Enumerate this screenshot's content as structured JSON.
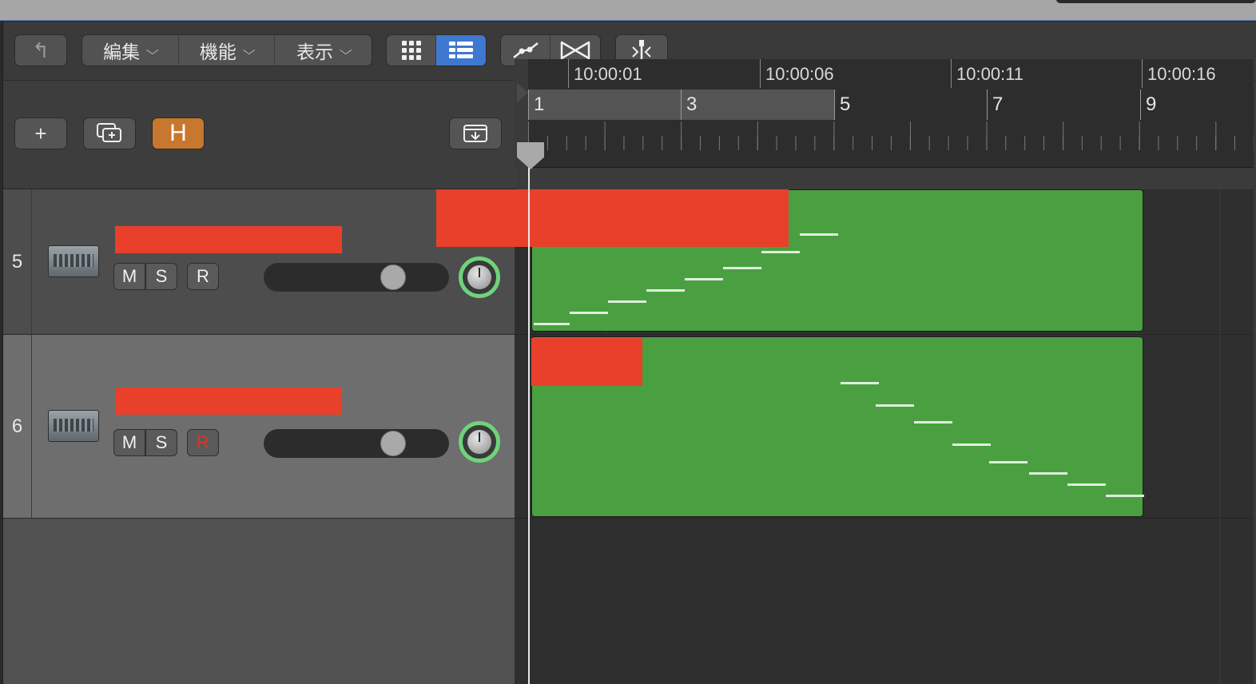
{
  "toolbar": {
    "back_icon": "up-arrow-icon",
    "menus": [
      "編集",
      "機能",
      "表示"
    ],
    "view_buttons": [
      "grid-view-icon",
      "list-view-icon"
    ],
    "tool_buttons": [
      "automation-icon",
      "flex-icon"
    ],
    "snap_button": "snap-icon"
  },
  "header": {
    "add_label": "+",
    "hide_label": "H"
  },
  "tracks": [
    {
      "number": "5",
      "name": "",
      "mute": "M",
      "solo": "S",
      "record": "R",
      "record_armed": false,
      "volume": 0.7
    },
    {
      "number": "6",
      "name": "",
      "mute": "M",
      "solo": "S",
      "record": "R",
      "record_armed": true,
      "volume": 0.7
    }
  ],
  "ruler": {
    "timecodes": [
      "10:00:01",
      "10:00:06",
      "10:00:11",
      "10:00:16"
    ],
    "bars": [
      "1",
      "3",
      "5",
      "7",
      "9"
    ]
  },
  "colors": {
    "region": "#4aa041",
    "redaction": "#e8402a",
    "accent": "#3f78d0",
    "hide_button": "#c8772e",
    "pan_ring": "#6fd37a"
  }
}
